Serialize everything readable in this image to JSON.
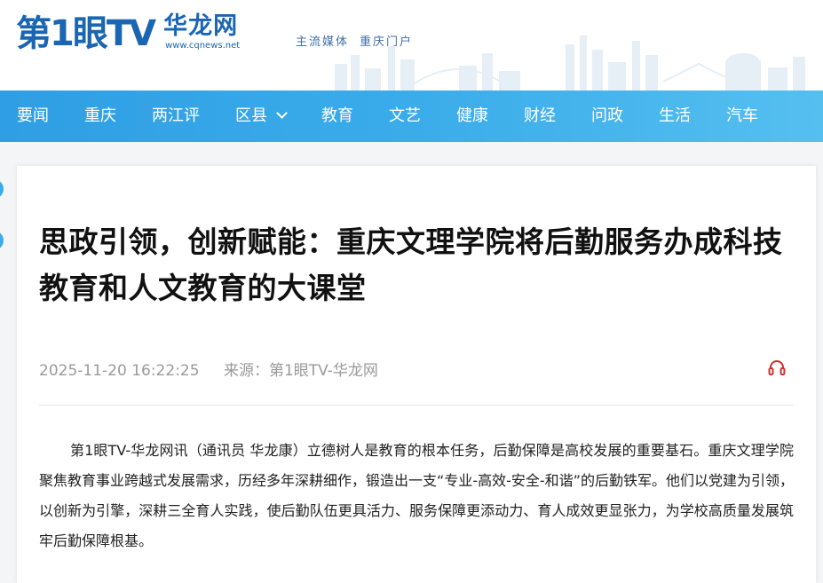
{
  "brand": {
    "logo_main": "第1眼TV",
    "logo_sub": "华龙网",
    "logo_url": "www.cqnews.net",
    "slogans": [
      "主流媒体",
      "重庆门户"
    ],
    "primary_color": "#1a66b3",
    "nav_color": "#3aacea"
  },
  "nav": {
    "items": [
      {
        "label": "要闻"
      },
      {
        "label": "重庆"
      },
      {
        "label": "两江评"
      },
      {
        "label": "区县",
        "icon": "chevron-down-icon"
      },
      {
        "label": "教育"
      },
      {
        "label": "文艺"
      },
      {
        "label": "健康"
      },
      {
        "label": "财经"
      },
      {
        "label": "问政"
      },
      {
        "label": "生活"
      },
      {
        "label": "汽车"
      }
    ]
  },
  "article": {
    "title": "思政引领，创新赋能：重庆文理学院将后勤服务办成科技教育和人文教育的大课堂",
    "datetime": "2025-11-20 16:22:25",
    "source_label": "来源：",
    "source": "第1眼TV-华龙网",
    "audio_icon": "headphones-icon",
    "paragraph1": "第1眼TV-华龙网讯（通讯员 华龙康）立德树人是教育的根本任务，后勤保障是高校发展的重要基石。重庆文理学院聚焦教育事业跨越式发展需求，历经多年深耕细作，锻造出一支“专业-高效-安全-和谐”的后勤铁军。他们以党建为引领，以创新为引擎，深耕三全育人实践，使后勤队伍更具活力、服务保障更添动力、育人成效更显张力，为学校高质量发展筑牢后勤保障根基。"
  }
}
